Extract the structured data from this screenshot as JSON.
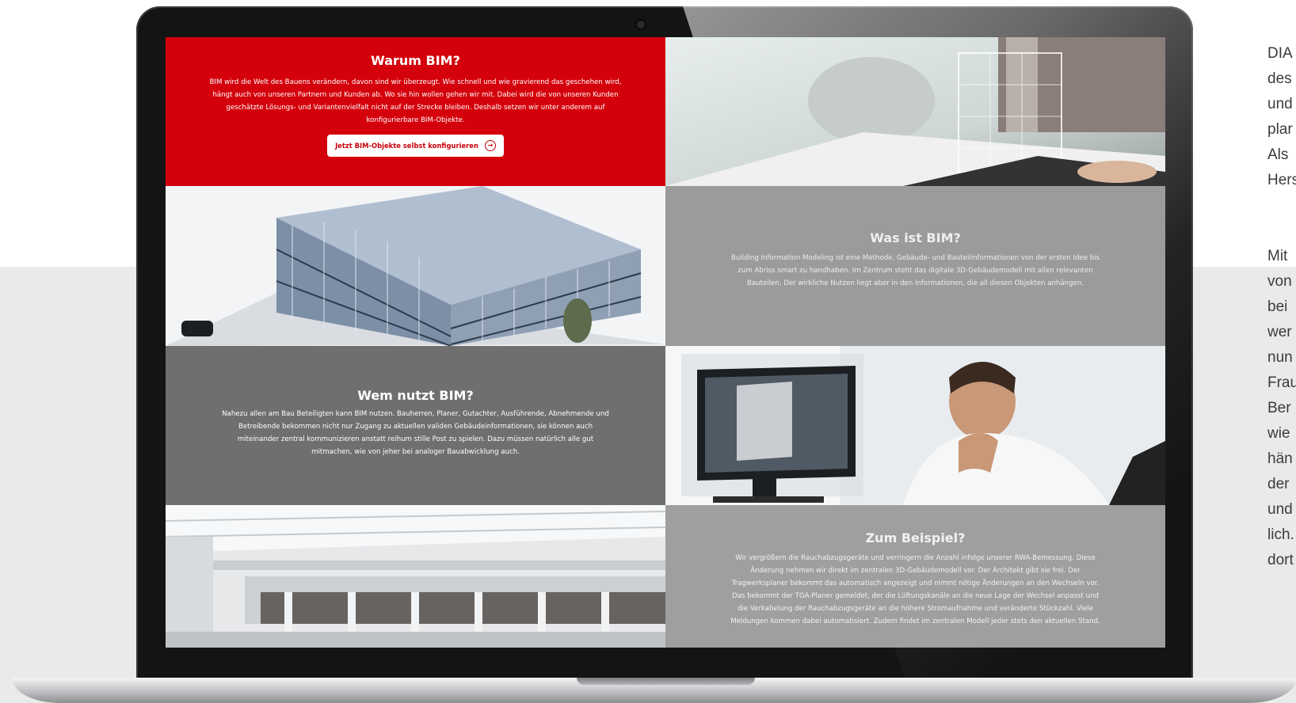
{
  "side_text": {
    "block1": [
      "DIA",
      "des",
      "und",
      "plar",
      "Als",
      "Hers"
    ],
    "block2": [
      "Mit",
      "von",
      "bei",
      "wer",
      "nun",
      "Frau",
      "Ber",
      "wie",
      "hän",
      "der",
      "und",
      "lich.",
      "dort"
    ]
  },
  "screen": {
    "warum": {
      "title": "Warum BIM?",
      "text": "BIM wird die Welt des Bauens verändern, davon sind wir überzeugt. Wie schnell und wie gravierend das geschehen wird, hängt auch von unseren Partnern und Kunden ab. Wo sie hin wollen gehen wir mit. Dabei wird die von unseren Kunden geschätzte Lösungs- und Variantenvielfalt nicht auf der Strecke bleiben. Deshalb setzen wir unter anderem auf konfigurierbare BIM-Objekte.",
      "cta": "Jetzt BIM-Objekte selbst konfigurieren"
    },
    "was": {
      "title": "Was ist BIM?",
      "text": "Building Information Modeling ist eine Methode, Gebäude- und Bauteilinformationen von der ersten Idee bis zum Abriss smart zu handhaben. Im Zentrum steht das digitale 3D-Gebäudemodell mit allen relevanten Bauteilen. Der wirkliche Nutzen liegt aber in den Informationen, die all diesen Objekten anhängen."
    },
    "wem": {
      "title": "Wem nutzt BIM?",
      "text": "Nahezu allen am Bau Beteiligten kann BIM nutzen. Bauherren, Planer, Gutachter, Ausführende, Abnehmende und Betreibende bekommen nicht nur Zugang zu aktuellen validen Gebäudeinformationen, sie können auch miteinander zentral kommunizieren anstatt reihum stille Post zu spielen. Dazu müssen natürlich alle gut mitmachen, wie von jeher bei analoger Bauabwicklung auch."
    },
    "beispiel": {
      "title": "Zum Beispiel?",
      "text": "Wir vergrößern die Rauchabzugsgeräte und verringern die Anzahl infolge unserer RWA-Bemessung. Diese Änderung nehmen wir direkt im zentralen 3D-Gebäudemodell vor. Der Architekt gibt sie frei. Der Tragwerksplaner bekommt das automatisch angezeigt und nimmt nötige Änderungen an den Wechseln vor. Das bekommt der TGA-Planer gemeldet, der die Lüftungskanäle an die neue Lage der Wechsel anpasst und die Verkabelung der Rauchabzugsgeräte an die höhere Stromaufnahme und veränderte Stückzahl. Viele Meldungen kommen dabei automatisiert. Zudem findet im zentralen Modell jeder stets den aktuellen Stand."
    }
  },
  "colors": {
    "red": "#d4000b",
    "grey_light": "#9b9b9b",
    "grey_dark": "#6f6f6f"
  }
}
